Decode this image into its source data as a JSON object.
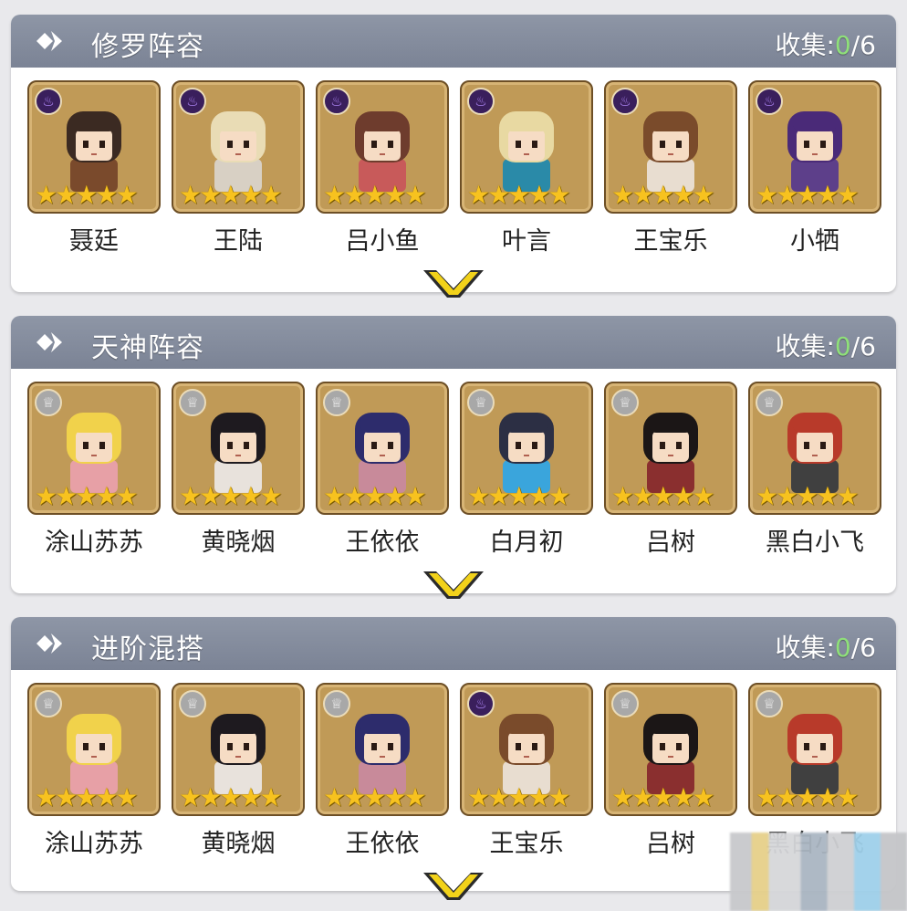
{
  "sections": [
    {
      "title": "修罗阵容",
      "collect_label": "收集:",
      "collect_count": "0",
      "collect_total": "/6",
      "heroes": [
        {
          "name": "聂廷",
          "badge": "flame-icon",
          "hair": "#3b2a22",
          "outfit": "#7a4a2c",
          "stars": 5
        },
        {
          "name": "王陆",
          "badge": "flame-icon",
          "hair": "#e9dcb5",
          "outfit": "#d8d0c4",
          "stars": 5
        },
        {
          "name": "吕小鱼",
          "badge": "flame-icon",
          "hair": "#6e3c2d",
          "outfit": "#c85a5a",
          "stars": 5
        },
        {
          "name": "叶言",
          "badge": "flame-icon",
          "hair": "#e8d9a2",
          "outfit": "#2a8aa8",
          "stars": 5
        },
        {
          "name": "王宝乐",
          "badge": "flame-icon",
          "hair": "#7a4b2b",
          "outfit": "#e8ddd0",
          "stars": 5
        },
        {
          "name": "小牺",
          "badge": "flame-icon",
          "hair": "#4a2a78",
          "outfit": "#5d3f8a",
          "stars": 5
        }
      ]
    },
    {
      "title": "天神阵容",
      "collect_label": "收集:",
      "collect_count": "0",
      "collect_total": "/6",
      "heroes": [
        {
          "name": "涂山苏苏",
          "badge": "crown-icon",
          "hair": "#f1d24b",
          "outfit": "#e7a0a6",
          "stars": 5
        },
        {
          "name": "黄晓烟",
          "badge": "crown-icon",
          "hair": "#1e1a1f",
          "outfit": "#e8e2dc",
          "stars": 5
        },
        {
          "name": "王依依",
          "badge": "crown-icon",
          "hair": "#2d2c6c",
          "outfit": "#c88a9a",
          "stars": 5
        },
        {
          "name": "白月初",
          "badge": "crown-icon",
          "hair": "#2c2f44",
          "outfit": "#3aa5dc",
          "stars": 5
        },
        {
          "name": "吕树",
          "badge": "crown-icon",
          "hair": "#1b1616",
          "outfit": "#8a2f2f",
          "stars": 5
        },
        {
          "name": "黑白小飞",
          "badge": "crown-icon",
          "hair": "#b83a2a",
          "outfit": "#404040",
          "stars": 5
        }
      ]
    },
    {
      "title": "进阶混搭",
      "collect_label": "收集:",
      "collect_count": "0",
      "collect_total": "/6",
      "heroes": [
        {
          "name": "涂山苏苏",
          "badge": "crown-icon",
          "hair": "#f1d24b",
          "outfit": "#e7a0a6",
          "stars": 5
        },
        {
          "name": "黄晓烟",
          "badge": "crown-icon",
          "hair": "#1e1a1f",
          "outfit": "#e8e2dc",
          "stars": 5
        },
        {
          "name": "王依依",
          "badge": "crown-icon",
          "hair": "#2d2c6c",
          "outfit": "#c88a9a",
          "stars": 5
        },
        {
          "name": "王宝乐",
          "badge": "flame-icon",
          "hair": "#7a4b2b",
          "outfit": "#e8ddd0",
          "stars": 5
        },
        {
          "name": "吕树",
          "badge": "crown-icon",
          "hair": "#1b1616",
          "outfit": "#8a2f2f",
          "stars": 5
        },
        {
          "name": "黑白小飞",
          "badge": "crown-icon",
          "hair": "#b83a2a",
          "outfit": "#404040",
          "stars": 5
        }
      ]
    }
  ],
  "colors": {
    "header": "#8a92a3",
    "card_bg": "#c09a57",
    "star": "#f7c21f",
    "collect_count": "#8fe07a",
    "chevron": "#f2d21a"
  }
}
